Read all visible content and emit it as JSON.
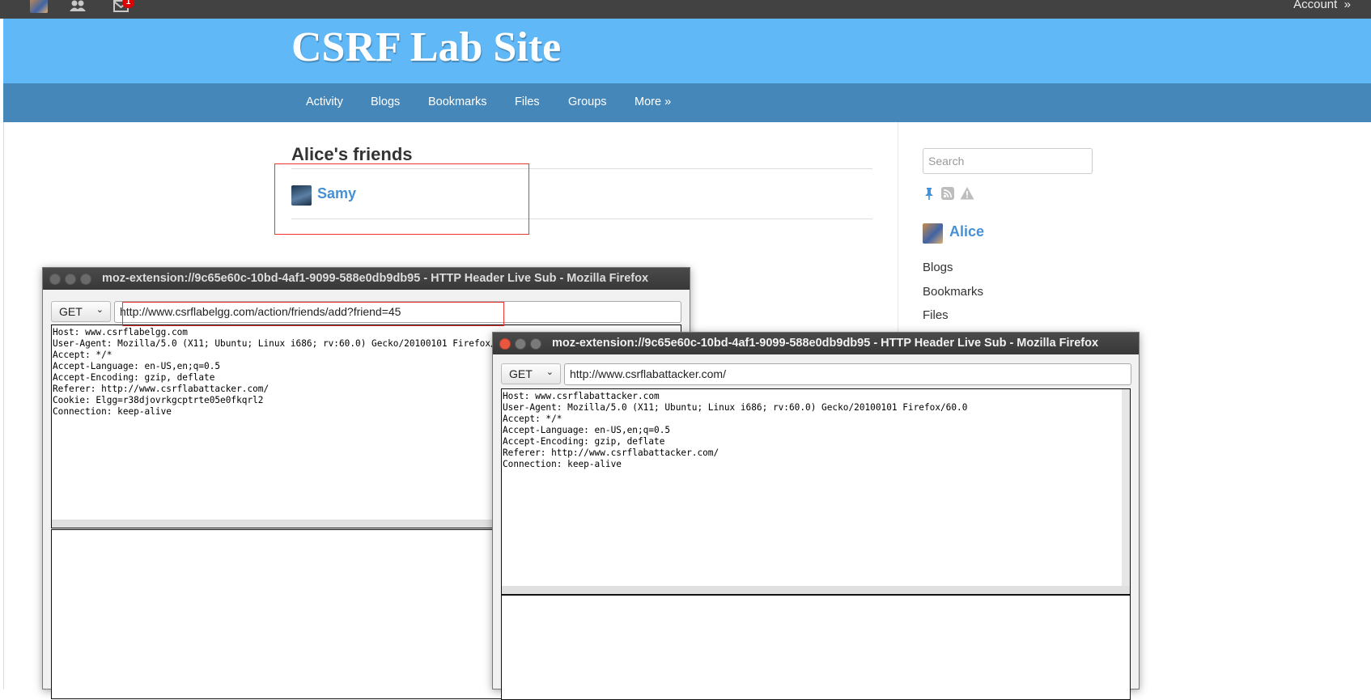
{
  "topbar": {
    "notification_count": "1",
    "account_label": "Account",
    "account_chevron": "»"
  },
  "header": {
    "site_title": "CSRF Lab Site"
  },
  "nav": {
    "items": [
      {
        "label": "Activity"
      },
      {
        "label": "Blogs"
      },
      {
        "label": "Bookmarks"
      },
      {
        "label": "Files"
      },
      {
        "label": "Groups"
      },
      {
        "label": "More »"
      }
    ]
  },
  "main": {
    "title": "Alice's friends",
    "friends": [
      {
        "name": "Samy"
      }
    ]
  },
  "sidebar": {
    "search_placeholder": "Search",
    "icons": [
      "pin-icon",
      "rss-icon",
      "warning-icon"
    ],
    "owner_name": "Alice",
    "links": [
      "Blogs",
      "Bookmarks",
      "Files"
    ]
  },
  "window1": {
    "title": "moz-extension://9c65e60c-10bd-4af1-9099-588e0db9db95 - HTTP Header Live Sub - Mozilla Firefox",
    "method": "GET",
    "url": "http://www.csrflabelgg.com/action/friends/add?friend=45",
    "headers": "Host: www.csrflabelgg.com\nUser-Agent: Mozilla/5.0 (X11; Ubuntu; Linux i686; rv:60.0) Gecko/20100101 Firefox/60.0\nAccept: */*\nAccept-Language: en-US,en;q=0.5\nAccept-Encoding: gzip, deflate\nReferer: http://www.csrflabattacker.com/\nCookie: Elgg=r38djovrkgcptrte05e0fkqrl2\nConnection: keep-alive"
  },
  "window2": {
    "title": "moz-extension://9c65e60c-10bd-4af1-9099-588e0db9db95 - HTTP Header Live Sub - Mozilla Firefox",
    "method": "GET",
    "url": "http://www.csrflabattacker.com/",
    "headers": "Host: www.csrflabattacker.com\nUser-Agent: Mozilla/5.0 (X11; Ubuntu; Linux i686; rv:60.0) Gecko/20100101 Firefox/60.0\nAccept: */*\nAccept-Language: en-US,en;q=0.5\nAccept-Encoding: gzip, deflate\nReferer: http://www.csrflabattacker.com/\nConnection: keep-alive"
  },
  "colors": {
    "header_bg": "#60b8f7",
    "nav_bg": "#4687b9",
    "link": "#4690d6",
    "highlight": "#ee3333"
  }
}
